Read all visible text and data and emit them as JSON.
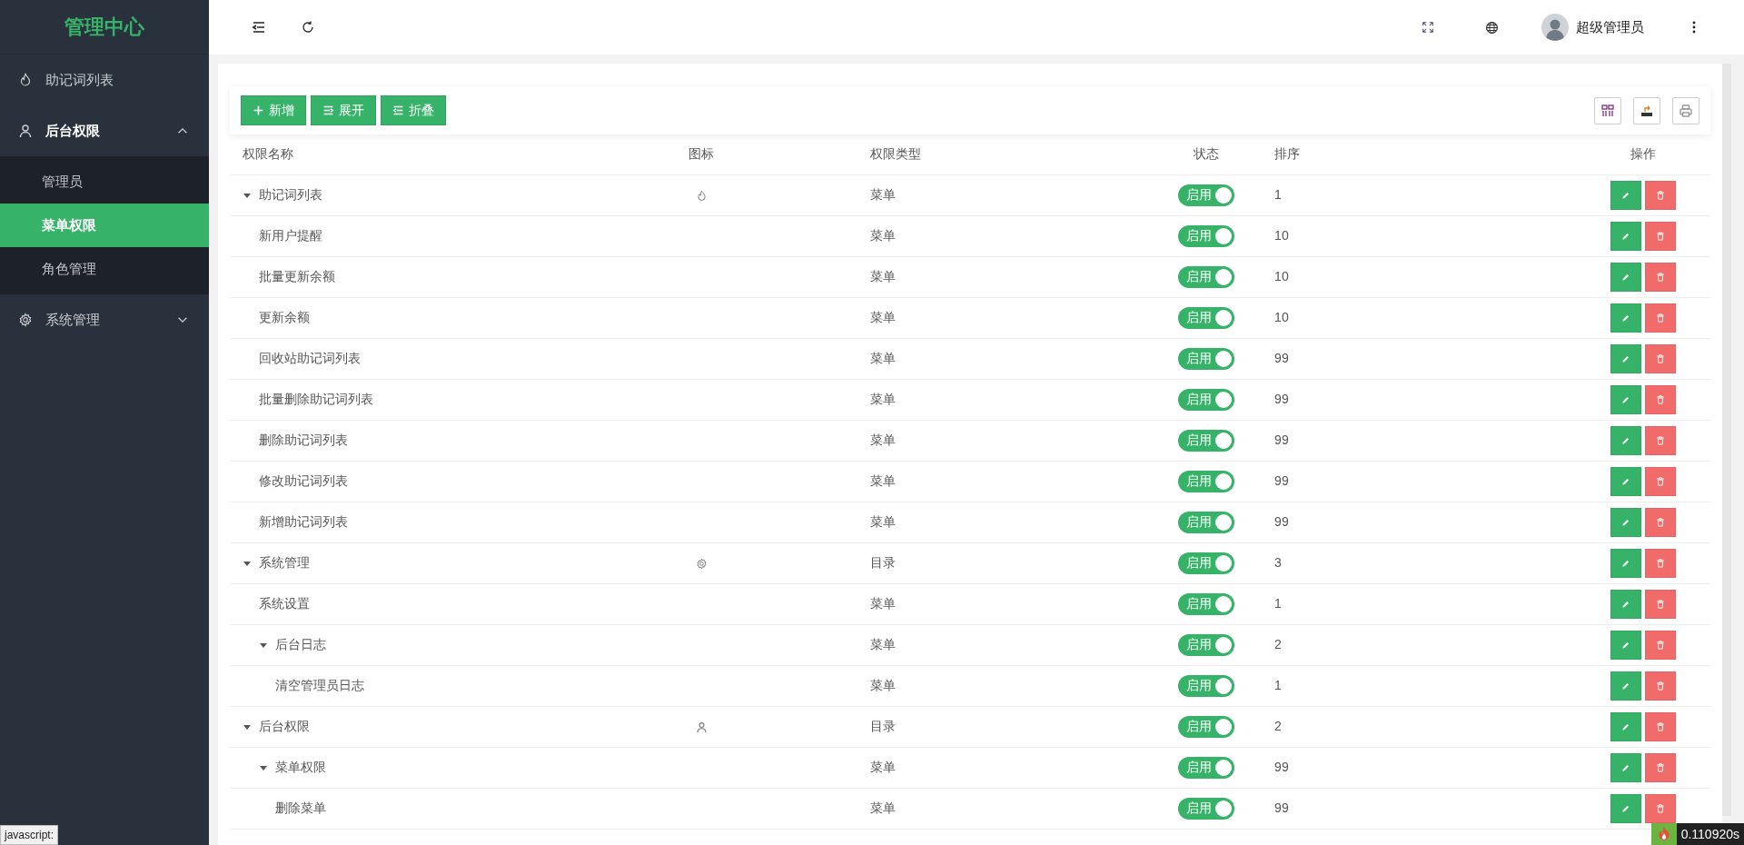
{
  "sidebar": {
    "logo": "管理中心",
    "items": [
      {
        "label": "助记词列表",
        "kind": "flame",
        "expanded": false
      },
      {
        "label": "后台权限",
        "kind": "user",
        "expanded": true,
        "expandable": true,
        "children": [
          {
            "label": "管理员",
            "selected": false
          },
          {
            "label": "菜单权限",
            "selected": true
          },
          {
            "label": "角色管理",
            "selected": false
          }
        ]
      },
      {
        "label": "系统管理",
        "kind": "gear",
        "expanded": false,
        "expandable": true
      }
    ]
  },
  "header": {
    "user_name": "超级管理员"
  },
  "toolbar": {
    "buttons": [
      {
        "label": "新增",
        "kind": "add"
      },
      {
        "label": "展开",
        "kind": "expand"
      },
      {
        "label": "折叠",
        "kind": "collapse"
      }
    ],
    "tools": [
      {
        "kind": "columns"
      },
      {
        "kind": "export"
      },
      {
        "kind": "print"
      }
    ]
  },
  "table": {
    "columns": [
      "权限名称",
      "图标",
      "权限类型",
      "状态",
      "排序",
      "操作"
    ],
    "rows": [
      {
        "name": "助记词列表",
        "kind": "flame",
        "type": "菜单",
        "status": "启用",
        "on": true,
        "sort": "1",
        "expanded": true,
        "children": [
          {
            "name": "新用户提醒",
            "type": "菜单",
            "status": "启用",
            "on": true,
            "sort": "10"
          },
          {
            "name": "批量更新余额",
            "type": "菜单",
            "status": "启用",
            "on": true,
            "sort": "10"
          },
          {
            "name": "更新余额",
            "type": "菜单",
            "status": "启用",
            "on": true,
            "sort": "10"
          },
          {
            "name": "回收站助记词列表",
            "type": "菜单",
            "status": "启用",
            "on": true,
            "sort": "99"
          },
          {
            "name": "批量删除助记词列表",
            "type": "菜单",
            "status": "启用",
            "on": true,
            "sort": "99"
          },
          {
            "name": "删除助记词列表",
            "type": "菜单",
            "status": "启用",
            "on": true,
            "sort": "99"
          },
          {
            "name": "修改助记词列表",
            "type": "菜单",
            "status": "启用",
            "on": true,
            "sort": "99"
          },
          {
            "name": "新增助记词列表",
            "type": "菜单",
            "status": "启用",
            "on": true,
            "sort": "99"
          }
        ]
      },
      {
        "name": "系统管理",
        "kind": "gear",
        "type": "目录",
        "status": "启用",
        "on": true,
        "sort": "3",
        "expanded": true,
        "children": [
          {
            "name": "系统设置",
            "type": "菜单",
            "status": "启用",
            "on": true,
            "sort": "1"
          },
          {
            "name": "后台日志",
            "type": "菜单",
            "status": "启用",
            "on": true,
            "sort": "2",
            "expanded": true,
            "children": [
              {
                "name": "清空管理员日志",
                "type": "菜单",
                "status": "启用",
                "on": true,
                "sort": "1"
              }
            ]
          }
        ]
      },
      {
        "name": "后台权限",
        "kind": "user",
        "type": "目录",
        "status": "启用",
        "on": true,
        "sort": "2",
        "expanded": true,
        "children": [
          {
            "name": "菜单权限",
            "type": "菜单",
            "status": "启用",
            "on": true,
            "sort": "99",
            "expanded": true,
            "children": [
              {
                "name": "删除菜单",
                "type": "菜单",
                "status": "启用",
                "on": true,
                "sort": "99"
              }
            ]
          }
        ]
      }
    ]
  },
  "status_bar": {
    "link_hint": "javascript:",
    "timing": "0.110920s"
  }
}
